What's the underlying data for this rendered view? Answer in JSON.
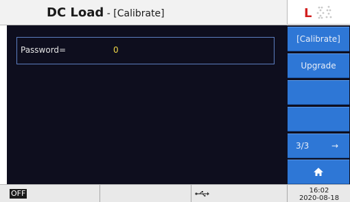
{
  "header": {
    "app_name": "DC Load",
    "separator": " - ",
    "mode": "[Calibrate]",
    "logo_text": "L",
    "logo_color": "#d21f1f"
  },
  "main": {
    "password_label": "Password=",
    "password_value": "0",
    "value_color": "#f0d848",
    "border_color": "#5d7fc2"
  },
  "side_menu": {
    "accent": "#2e77d6",
    "items": [
      {
        "label": "[Calibrate]"
      },
      {
        "label": "Upgrade"
      },
      {
        "label": ""
      },
      {
        "label": ""
      },
      {
        "label": "3/3",
        "arrow": "→"
      },
      {
        "icon": "home-icon"
      }
    ]
  },
  "status_bar": {
    "output_state": "OFF",
    "time": "16:02",
    "date": "2020-08-18",
    "usb_icon": "usb-icon"
  }
}
